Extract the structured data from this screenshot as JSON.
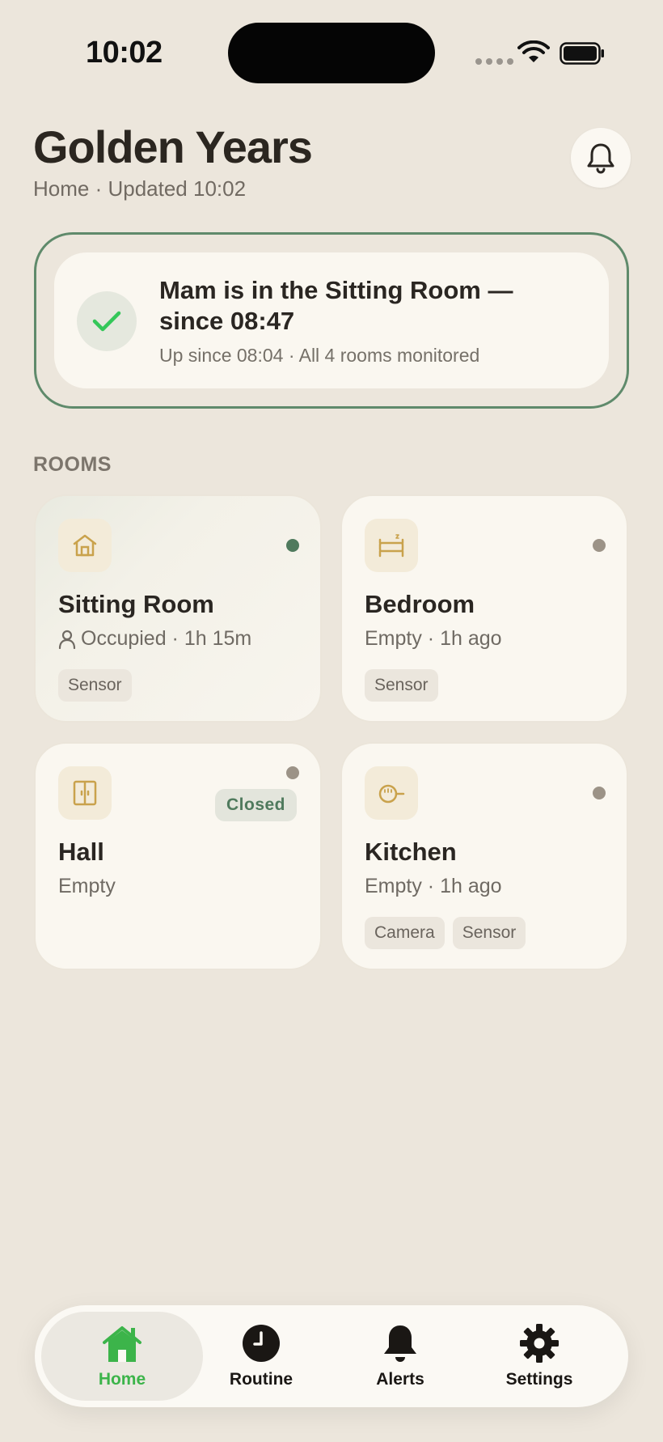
{
  "status_bar": {
    "time": "10:02"
  },
  "header": {
    "title": "Golden Years",
    "subtitle": "Home · Updated 10:02"
  },
  "hero": {
    "title": "Mam is in the Sitting Room — since 08:47",
    "subtitle": "Up since 08:04 · All 4 rooms monitored"
  },
  "section_label": "ROOMS",
  "rooms": [
    {
      "name": "Sitting Room",
      "status": "Occupied · 1h 15m",
      "tags": [
        "Sensor"
      ],
      "icon": "house-icon",
      "indicator": "active"
    },
    {
      "name": "Bedroom",
      "status": "Empty · 1h ago",
      "tags": [
        "Sensor"
      ],
      "icon": "bed-icon",
      "indicator": "inactive"
    },
    {
      "name": "Hall",
      "status": "Empty",
      "badge": "Closed",
      "tags": [],
      "icon": "door-icon",
      "indicator": "inactive"
    },
    {
      "name": "Kitchen",
      "status": "Empty · 1h ago",
      "tags": [
        "Camera",
        "Sensor"
      ],
      "icon": "kettle-icon",
      "indicator": "inactive"
    }
  ],
  "tabs": [
    {
      "label": "Home",
      "icon": "home-icon",
      "active": true
    },
    {
      "label": "Routine",
      "icon": "clock-icon",
      "active": false
    },
    {
      "label": "Alerts",
      "icon": "bell-icon",
      "active": false
    },
    {
      "label": "Settings",
      "icon": "gear-icon",
      "active": false
    }
  ],
  "colors": {
    "background": "#ece6dc",
    "card": "#faf7f0",
    "accent_green": "#4f7a5d",
    "active_tab": "#3cb44a",
    "icon_gold": "#c9a24c"
  }
}
